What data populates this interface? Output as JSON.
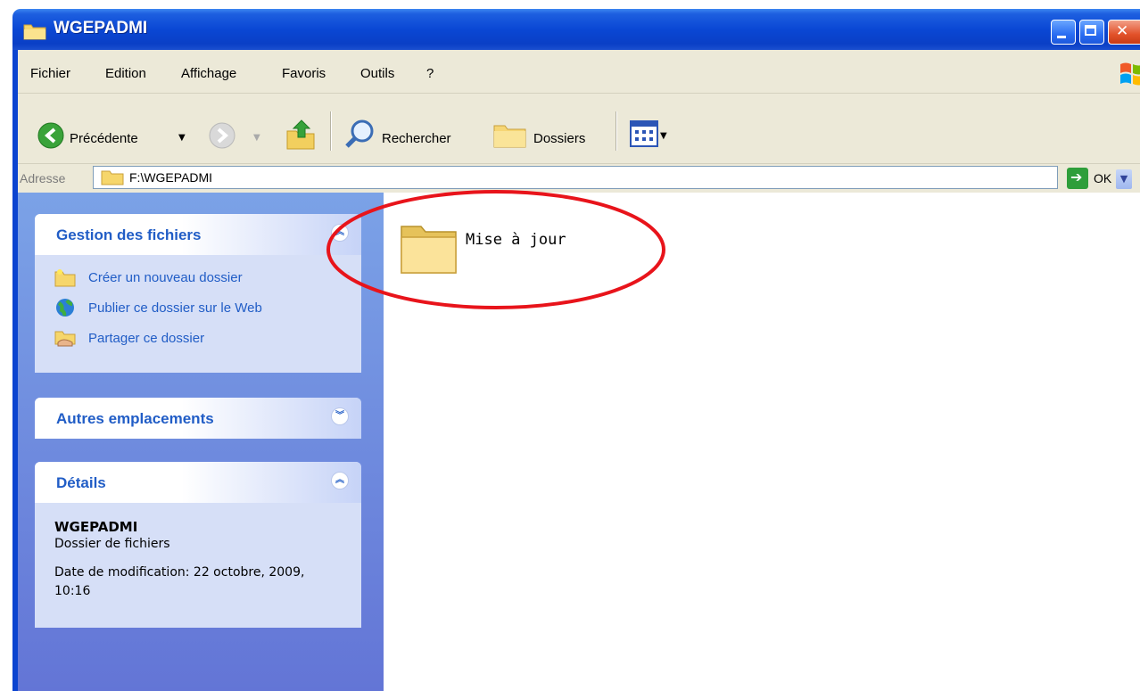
{
  "window": {
    "title": "WGEPADMI"
  },
  "menu": [
    "Fichier",
    "Edition",
    "Affichage",
    "Favoris",
    "Outils",
    "?"
  ],
  "toolbar": {
    "back_label": "Précédente",
    "search_label": "Rechercher",
    "folders_label": "Dossiers"
  },
  "address": {
    "label": "Adresse",
    "path": "F:\\WGEPADMI",
    "go_label": "OK"
  },
  "sidebar": {
    "file_tasks": {
      "title": "Gestion des fichiers",
      "items": [
        "Créer un nouveau dossier",
        "Publier ce dossier sur le Web",
        "Partager ce dossier"
      ]
    },
    "other_places": {
      "title": "Autres emplacements"
    },
    "details": {
      "title": "Détails",
      "name": "WGEPADMI",
      "type": "Dossier de fichiers",
      "modified": "Date de modification: 22 octobre, 2009, 10:16"
    }
  },
  "content": {
    "items": [
      {
        "name": "Mise à jour",
        "icon": "folder-icon"
      }
    ]
  },
  "annotation": {
    "color": "#e8141b"
  }
}
